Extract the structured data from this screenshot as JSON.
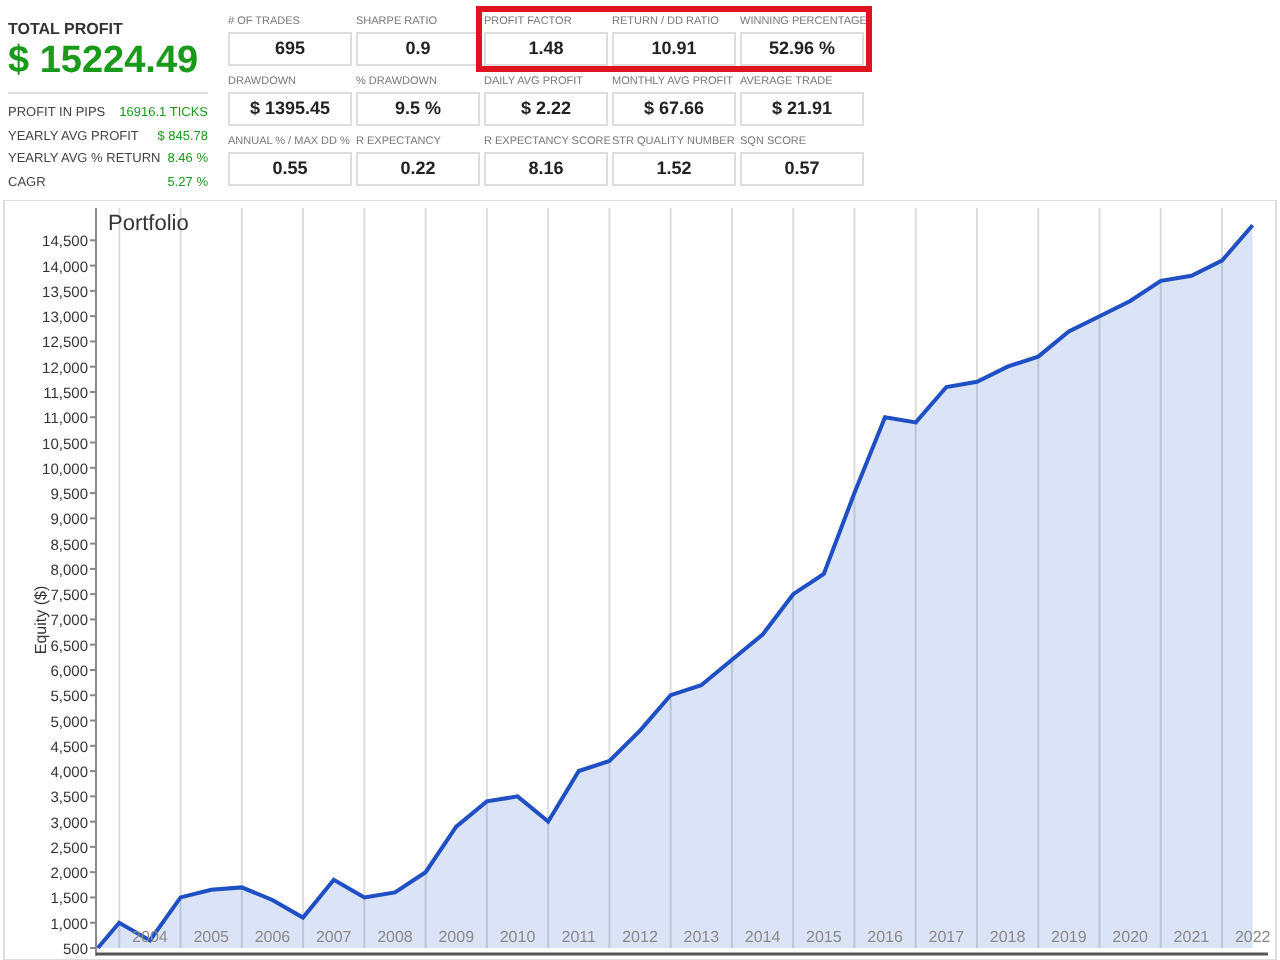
{
  "summary": {
    "title": "TOTAL PROFIT",
    "total": "$ 15224.49",
    "rows": [
      {
        "label": "PROFIT IN PIPS",
        "value": "16916.1 TICKS"
      },
      {
        "label": "YEARLY AVG PROFIT",
        "value": "$ 845.78"
      },
      {
        "label": "YEARLY AVG % RETURN",
        "value": "8.46 %"
      },
      {
        "label": "CAGR",
        "value": "5.27 %"
      }
    ]
  },
  "metrics": [
    {
      "label": "# OF TRADES",
      "value": "695",
      "highlighted": false
    },
    {
      "label": "SHARPE RATIO",
      "value": "0.9",
      "highlighted": false
    },
    {
      "label": "PROFIT FACTOR",
      "value": "1.48",
      "highlighted": true
    },
    {
      "label": "RETURN / DD RATIO",
      "value": "10.91",
      "highlighted": true
    },
    {
      "label": "WINNING PERCENTAGE",
      "value": "52.96 %",
      "highlighted": true
    },
    {
      "label": "DRAWDOWN",
      "value": "$ 1395.45",
      "highlighted": false
    },
    {
      "label": "% DRAWDOWN",
      "value": "9.5 %",
      "highlighted": false
    },
    {
      "label": "DAILY AVG PROFIT",
      "value": "$ 2.22",
      "highlighted": false
    },
    {
      "label": "MONTHLY AVG PROFIT",
      "value": "$ 67.66",
      "highlighted": false
    },
    {
      "label": "AVERAGE TRADE",
      "value": "$ 21.91",
      "highlighted": false
    },
    {
      "label": "ANNUAL % / MAX DD %",
      "value": "0.55",
      "highlighted": false
    },
    {
      "label": "R EXPECTANCY",
      "value": "0.22",
      "highlighted": false
    },
    {
      "label": "R EXPECTANCY SCORE",
      "value": "8.16",
      "highlighted": false
    },
    {
      "label": "STR QUALITY NUMBER",
      "value": "1.52",
      "highlighted": false
    },
    {
      "label": "SQN SCORE",
      "value": "0.57",
      "highlighted": false
    }
  ],
  "chart": {
    "chart_data": {
      "type": "area",
      "title": "Portfolio",
      "ylabel": "Equity ($)",
      "x": [
        2003.65,
        2004.0,
        2004.5,
        2005.0,
        2005.5,
        2006.0,
        2006.5,
        2007.0,
        2007.5,
        2008.0,
        2008.5,
        2009.0,
        2009.5,
        2010.0,
        2010.5,
        2011.0,
        2011.5,
        2012.0,
        2012.5,
        2013.0,
        2013.5,
        2014.0,
        2014.5,
        2015.0,
        2015.5,
        2016.0,
        2016.5,
        2017.0,
        2017.5,
        2018.0,
        2018.5,
        2019.0,
        2019.5,
        2020.0,
        2020.5,
        2021.0,
        2021.5,
        2022.0,
        2022.5
      ],
      "series": [
        {
          "color": "#1f4fc4",
          "values": [
            500,
            1000,
            650,
            1500,
            1650,
            1700,
            1450,
            1100,
            1850,
            1500,
            1600,
            2000,
            2900,
            3400,
            3500,
            3000,
            4000,
            4200,
            4800,
            5500,
            5700,
            6200,
            6700,
            7500,
            7900,
            9500,
            11000,
            10900,
            11600,
            11700,
            12000,
            12200,
            12700,
            13000,
            13300,
            13700,
            13800,
            14100,
            14800
          ]
        }
      ],
      "xlim": [
        2003.62,
        2022.75
      ],
      "ylim": [
        500,
        15100
      ],
      "xticks": [
        {
          "value": 2004.5,
          "label": "2004"
        },
        {
          "value": 2005.5,
          "label": "2005"
        },
        {
          "value": 2006.5,
          "label": "2006"
        },
        {
          "value": 2007.5,
          "label": "2007"
        },
        {
          "value": 2008.5,
          "label": "2008"
        },
        {
          "value": 2009.5,
          "label": "2009"
        },
        {
          "value": 2010.5,
          "label": "2010"
        },
        {
          "value": 2011.5,
          "label": "2011"
        },
        {
          "value": 2012.5,
          "label": "2012"
        },
        {
          "value": 2013.5,
          "label": "2013"
        },
        {
          "value": 2014.5,
          "label": "2014"
        },
        {
          "value": 2015.5,
          "label": "2015"
        },
        {
          "value": 2016.5,
          "label": "2016"
        },
        {
          "value": 2017.5,
          "label": "2017"
        },
        {
          "value": 2018.5,
          "label": "2018"
        },
        {
          "value": 2019.5,
          "label": "2019"
        },
        {
          "value": 2020.5,
          "label": "2020"
        },
        {
          "value": 2021.5,
          "label": "2021"
        },
        {
          "value": 2022.5,
          "label": "2022"
        }
      ],
      "yticks": [
        {
          "value": 500,
          "label": "500"
        },
        {
          "value": 1000,
          "label": "1,000"
        },
        {
          "value": 1500,
          "label": "1,500"
        },
        {
          "value": 2000,
          "label": "2,000"
        },
        {
          "value": 2500,
          "label": "2,500"
        },
        {
          "value": 3000,
          "label": "3,000"
        },
        {
          "value": 3500,
          "label": "3,500"
        },
        {
          "value": 4000,
          "label": "4,000"
        },
        {
          "value": 4500,
          "label": "4,500"
        },
        {
          "value": 5000,
          "label": "5,000"
        },
        {
          "value": 5500,
          "label": "5,500"
        },
        {
          "value": 6000,
          "label": "6,000"
        },
        {
          "value": 6500,
          "label": "6,500"
        },
        {
          "value": 7000,
          "label": "7,000"
        },
        {
          "value": 7500,
          "label": "7,500"
        },
        {
          "value": 8000,
          "label": "8,000"
        },
        {
          "value": 8500,
          "label": "8,500"
        },
        {
          "value": 9000,
          "label": "9,000"
        },
        {
          "value": 9500,
          "label": "9,500"
        },
        {
          "value": 10000,
          "label": "10,000"
        },
        {
          "value": 10500,
          "label": "10,500"
        },
        {
          "value": 11000,
          "label": "11,000"
        },
        {
          "value": 11500,
          "label": "11,500"
        },
        {
          "value": 12000,
          "label": "12,000"
        },
        {
          "value": 12500,
          "label": "12,500"
        },
        {
          "value": 13000,
          "label": "13,000"
        },
        {
          "value": 13500,
          "label": "13,500"
        },
        {
          "value": 14000,
          "label": "14,000"
        },
        {
          "value": 14500,
          "label": "14,500"
        }
      ]
    }
  }
}
